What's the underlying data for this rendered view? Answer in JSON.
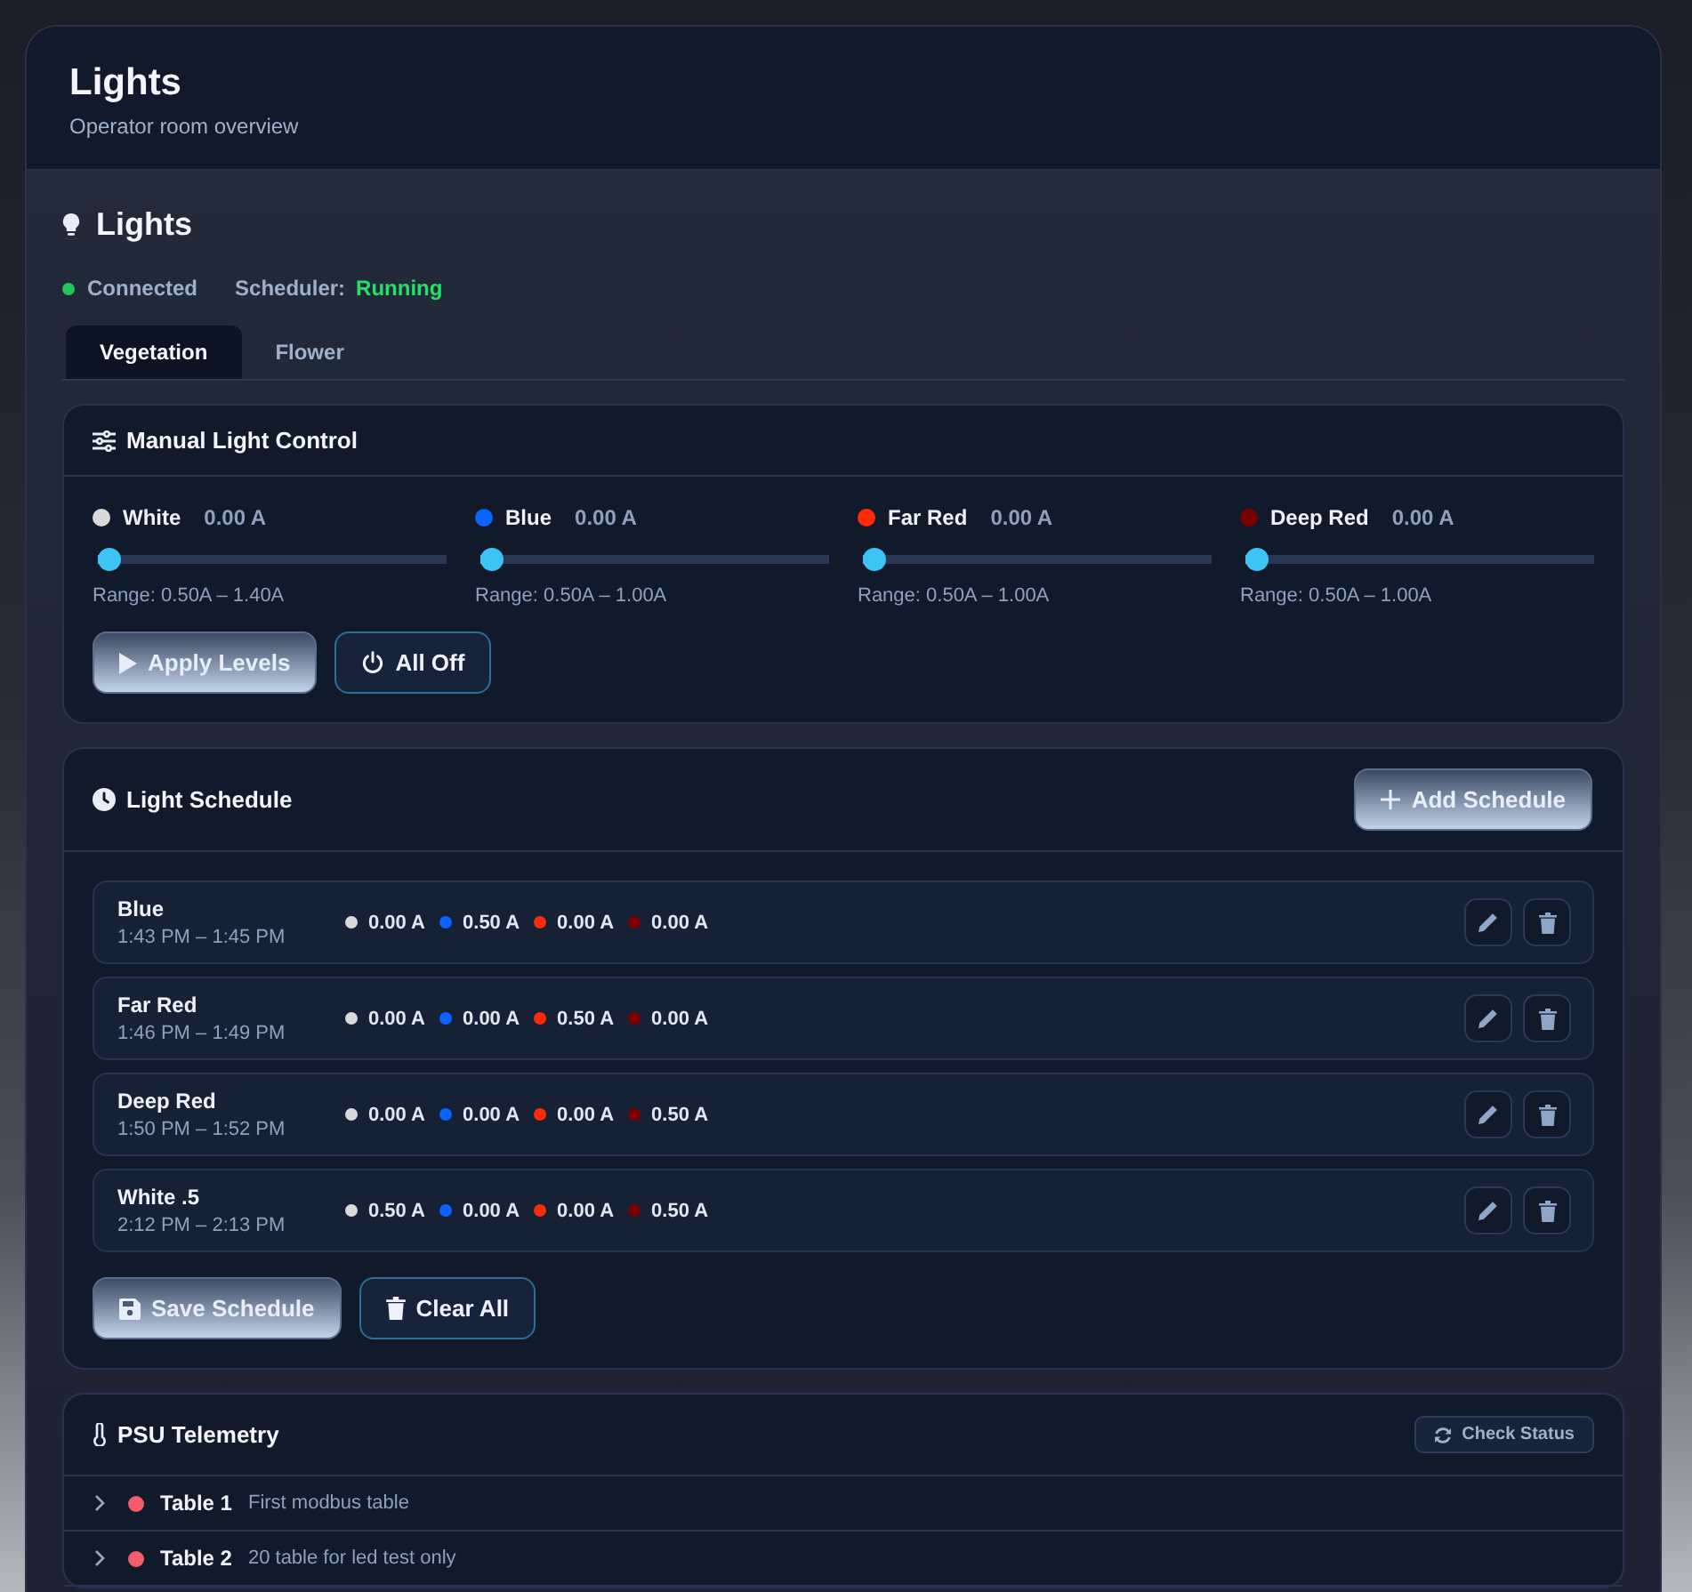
{
  "header": {
    "title": "Lights",
    "subtitle": "Operator room overview"
  },
  "section_title": "Lights",
  "status": {
    "label": "Connected",
    "connected": true
  },
  "scheduler": {
    "label": "Scheduler:",
    "value": "Running",
    "running": true
  },
  "tabs": [
    {
      "label": "Vegetation",
      "selected": true
    },
    {
      "label": "Flower",
      "selected": false
    }
  ],
  "manual": {
    "title": "Manual Light Control",
    "channels": [
      {
        "name": "White",
        "reading": "0.00 A",
        "level": 0,
        "range": "Range: 0.50A – 1.40A",
        "color": "#d9d9d9"
      },
      {
        "name": "Blue",
        "reading": "0.00 A",
        "level": 0,
        "range": "Range: 0.50A – 1.00A",
        "color": "#0a63ff"
      },
      {
        "name": "Far Red",
        "reading": "0.00 A",
        "level": 0,
        "range": "Range: 0.50A – 1.00A",
        "color": "#ff2a0a"
      },
      {
        "name": "Deep Red",
        "reading": "0.00 A",
        "level": 0,
        "range": "Range: 0.50A – 1.00A",
        "color": "#7a0000"
      }
    ],
    "buttons": [
      {
        "label": "Apply Levels",
        "kind": "primary"
      },
      {
        "label": "All Off",
        "kind": "outline"
      }
    ]
  },
  "schedule": {
    "title": "Light Schedule",
    "add_button": "Add Schedule",
    "rows": [
      {
        "name": "Blue",
        "time": "1:43 PM – 1:45 PM",
        "values": [
          "0.00 A",
          "0.50 A",
          "0.00 A",
          "0.00 A"
        ]
      },
      {
        "name": "Far Red",
        "time": "1:46 PM – 1:49 PM",
        "values": [
          "0.00 A",
          "0.00 A",
          "0.50 A",
          "0.00 A"
        ]
      },
      {
        "name": "Deep Red",
        "time": "1:50 PM – 1:52 PM",
        "values": [
          "0.00 A",
          "0.00 A",
          "0.00 A",
          "0.50 A"
        ]
      },
      {
        "name": "White .5",
        "time": "2:12 PM – 2:13 PM",
        "values": [
          "0.50 A",
          "0.00 A",
          "0.00 A",
          "0.50 A"
        ]
      }
    ],
    "buttons": [
      {
        "label": "Save Schedule",
        "kind": "primary"
      },
      {
        "label": "Clear All",
        "kind": "outline"
      }
    ]
  },
  "telemetry": {
    "title": "PSU Telemetry",
    "check_button": "Check Status",
    "tables": [
      {
        "name": "Table 1",
        "description": "First modbus table",
        "expanded": false,
        "color": "#f25c6c"
      },
      {
        "name": "Table 2",
        "description": "20 table for led test only",
        "expanded": false,
        "color": "#f25c6c"
      }
    ]
  }
}
